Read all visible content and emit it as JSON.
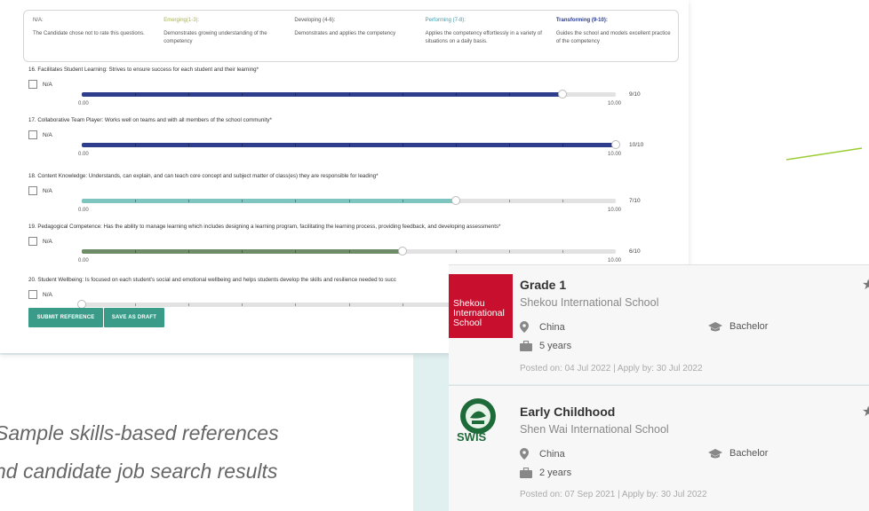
{
  "legend": [
    {
      "title": "N/A:",
      "desc": "The Candidate chose not to rate this questions.",
      "color": "#666666"
    },
    {
      "title": "Emerging(1-3):",
      "desc": "Demonstrates growing understanding of the competency",
      "color": "#a7b24a"
    },
    {
      "title": "Developing (4-6):",
      "desc": "Demonstrates and applies the competency",
      "color": "#555555"
    },
    {
      "title": "Performing (7-8):",
      "desc": "Applies the competency effortlessly in a variety of situations on a daily basis.",
      "color": "#3a9fb0"
    },
    {
      "title": "Transforming (9-10):",
      "desc": "Guides the school and models excellent practice of the competency",
      "color": "#2b3c8f"
    }
  ],
  "questions": [
    {
      "text": "16. Facilitates Student Learning: Strives to ensure success for each student and their learning*",
      "na": "N/A",
      "min": "0.00",
      "max": "10.00",
      "score": "9/10",
      "value": 9,
      "color": "#2e3d8c"
    },
    {
      "text": "17. Collaborative Team Player: Works well on teams and with all members of the school community*",
      "na": "N/A",
      "min": "0.00",
      "max": "10.00",
      "score": "10/10",
      "value": 10,
      "color": "#2e3d8c"
    },
    {
      "text": "18. Content Knowledge: Understands, can explain, and can teach core concept and subject matter of class(es) they are responsible for leading*",
      "na": "N/A",
      "min": "0.00",
      "max": "10.00",
      "score": "7/10",
      "value": 7,
      "color": "#7ec5c0"
    },
    {
      "text": "19. Pedagogical Competence: Has the ability to manage learning which includes designing a learning program, facilitating the learning process, providing feedback, and developing assessments*",
      "na": "N/A",
      "min": "0.00",
      "max": "10.00",
      "score": "6/10",
      "value": 6,
      "color": "#6f8c68"
    },
    {
      "text": "20. Student Wellbeing: Is focused on each student's social and emotional wellbeing and helps students develop the skills and resilience needed to succ",
      "na": "N/A",
      "min": "0.00",
      "max": "",
      "score": "",
      "value": 0,
      "color": "#cccccc"
    }
  ],
  "buttons": {
    "submit": "SUBMIT REFERENCE",
    "draft": "SAVE AS DRAFT"
  },
  "caption": {
    "line1": "Sample skills-based references",
    "line2": "nd candidate job search results"
  },
  "jobs": [
    {
      "title": "Grade 1",
      "school": "Shekou International School",
      "country": "China",
      "degree": "Bachelor",
      "experience": "5 years",
      "posted": "Posted on: 04 Jul 2022 | Apply by: 30 Jul 2022",
      "logo_text": "Shekou International School"
    },
    {
      "title": "Early Childhood",
      "school": "Shen Wai International School",
      "country": "China",
      "degree": "Bachelor",
      "experience": "2 years",
      "posted": "Posted on: 07 Sep 2021 | Apply by: 30 Jul 2022",
      "logo_text": "SWIS"
    }
  ],
  "colors": {
    "accent": "#3a9b88",
    "logo_red": "#c8102e",
    "green_line": "#9acd32"
  }
}
